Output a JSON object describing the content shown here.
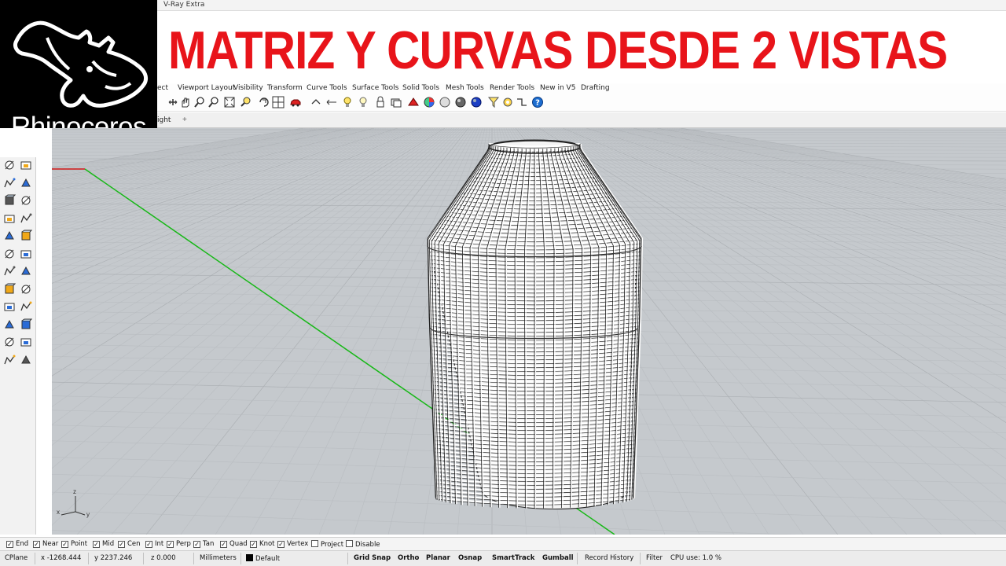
{
  "logo": {
    "brand": "Rhinoceros"
  },
  "menubar": {
    "plugin_label": "V-Ray Extra"
  },
  "headline": "MATRIZ Y CURVAS DESDE 2 VISTAS",
  "toolbar_tabs": [
    "ect",
    "Viewport Layout",
    "Visibility",
    "Transform",
    "Curve Tools",
    "Surface Tools",
    "Solid Tools",
    "Mesh Tools",
    "Render Tools",
    "New in V5",
    "Drafting"
  ],
  "viewport": {
    "tab_label": "Right",
    "tab_visible": "ight",
    "add_tab": "+",
    "axis_x": "x",
    "axis_y": "y",
    "axis_z": "z"
  },
  "osnaps": [
    {
      "label": "End",
      "checked": true
    },
    {
      "label": "Near",
      "checked": true
    },
    {
      "label": "Point",
      "checked": true
    },
    {
      "label": "Mid",
      "checked": true
    },
    {
      "label": "Cen",
      "checked": true
    },
    {
      "label": "Int",
      "checked": true
    },
    {
      "label": "Perp",
      "checked": true
    },
    {
      "label": "Tan",
      "checked": true
    },
    {
      "label": "Quad",
      "checked": true
    },
    {
      "label": "Knot",
      "checked": true
    },
    {
      "label": "Vertex",
      "checked": true
    },
    {
      "label": "Project",
      "checked": false
    },
    {
      "label": "Disable",
      "checked": false
    }
  ],
  "status": {
    "cplane": "CPlane",
    "x": "x -1268.444",
    "y": "y 2237.246",
    "z": "z 0.000",
    "units": "Millimeters",
    "layer": "Default",
    "grid_snap": "Grid Snap",
    "ortho": "Ortho",
    "planar": "Planar",
    "osnap": "Osnap",
    "smarttrack": "SmartTrack",
    "gumball": "Gumball",
    "record_history": "Record History",
    "filter": "Filter",
    "cpu": "CPU use: 1.0 %"
  },
  "colors": {
    "headline": "#e8141a",
    "viewport_bg": "#c5c9cd",
    "grid_minor": "#b9bdc1",
    "grid_major": "#a9adb1",
    "x_axis": "#d01818",
    "y_axis": "#18b818",
    "model": "#ffffff"
  },
  "icons": {
    "toolbar": [
      "pan-icon",
      "zoom-window-icon",
      "zoom-dynamic-icon",
      "zoom-extents-icon",
      "zoom-selected-icon",
      "rotate-view-icon",
      "four-viewports-icon",
      "car-render-icon",
      "undo-view-icon",
      "named-views-icon",
      "lights-icon",
      "lock-icon",
      "layer-icon",
      "render-icon",
      "color-wheel-icon",
      "shaded-sphere-icon",
      "rendered-sphere-icon",
      "blue-sphere-icon",
      "select-filter-icon",
      "options-gear-icon",
      "snap-icon",
      "help-icon"
    ],
    "left": [
      "circle-icon",
      "polyline-icon",
      "rectangle-icon",
      "arc-icon",
      "surface-icon",
      "revolve-icon",
      "box-icon",
      "sphere-icon",
      "extrude-icon",
      "sweep-icon",
      "gear-icon",
      "lightning-icon",
      "dimension-icon",
      "boolean-icon",
      "fillet-icon",
      "blend-icon",
      "text-icon",
      "array-icon",
      "group-icon",
      "mesh-icon",
      "grid-icon",
      "analyze-icon",
      "check-icon",
      "paint-icon"
    ]
  }
}
